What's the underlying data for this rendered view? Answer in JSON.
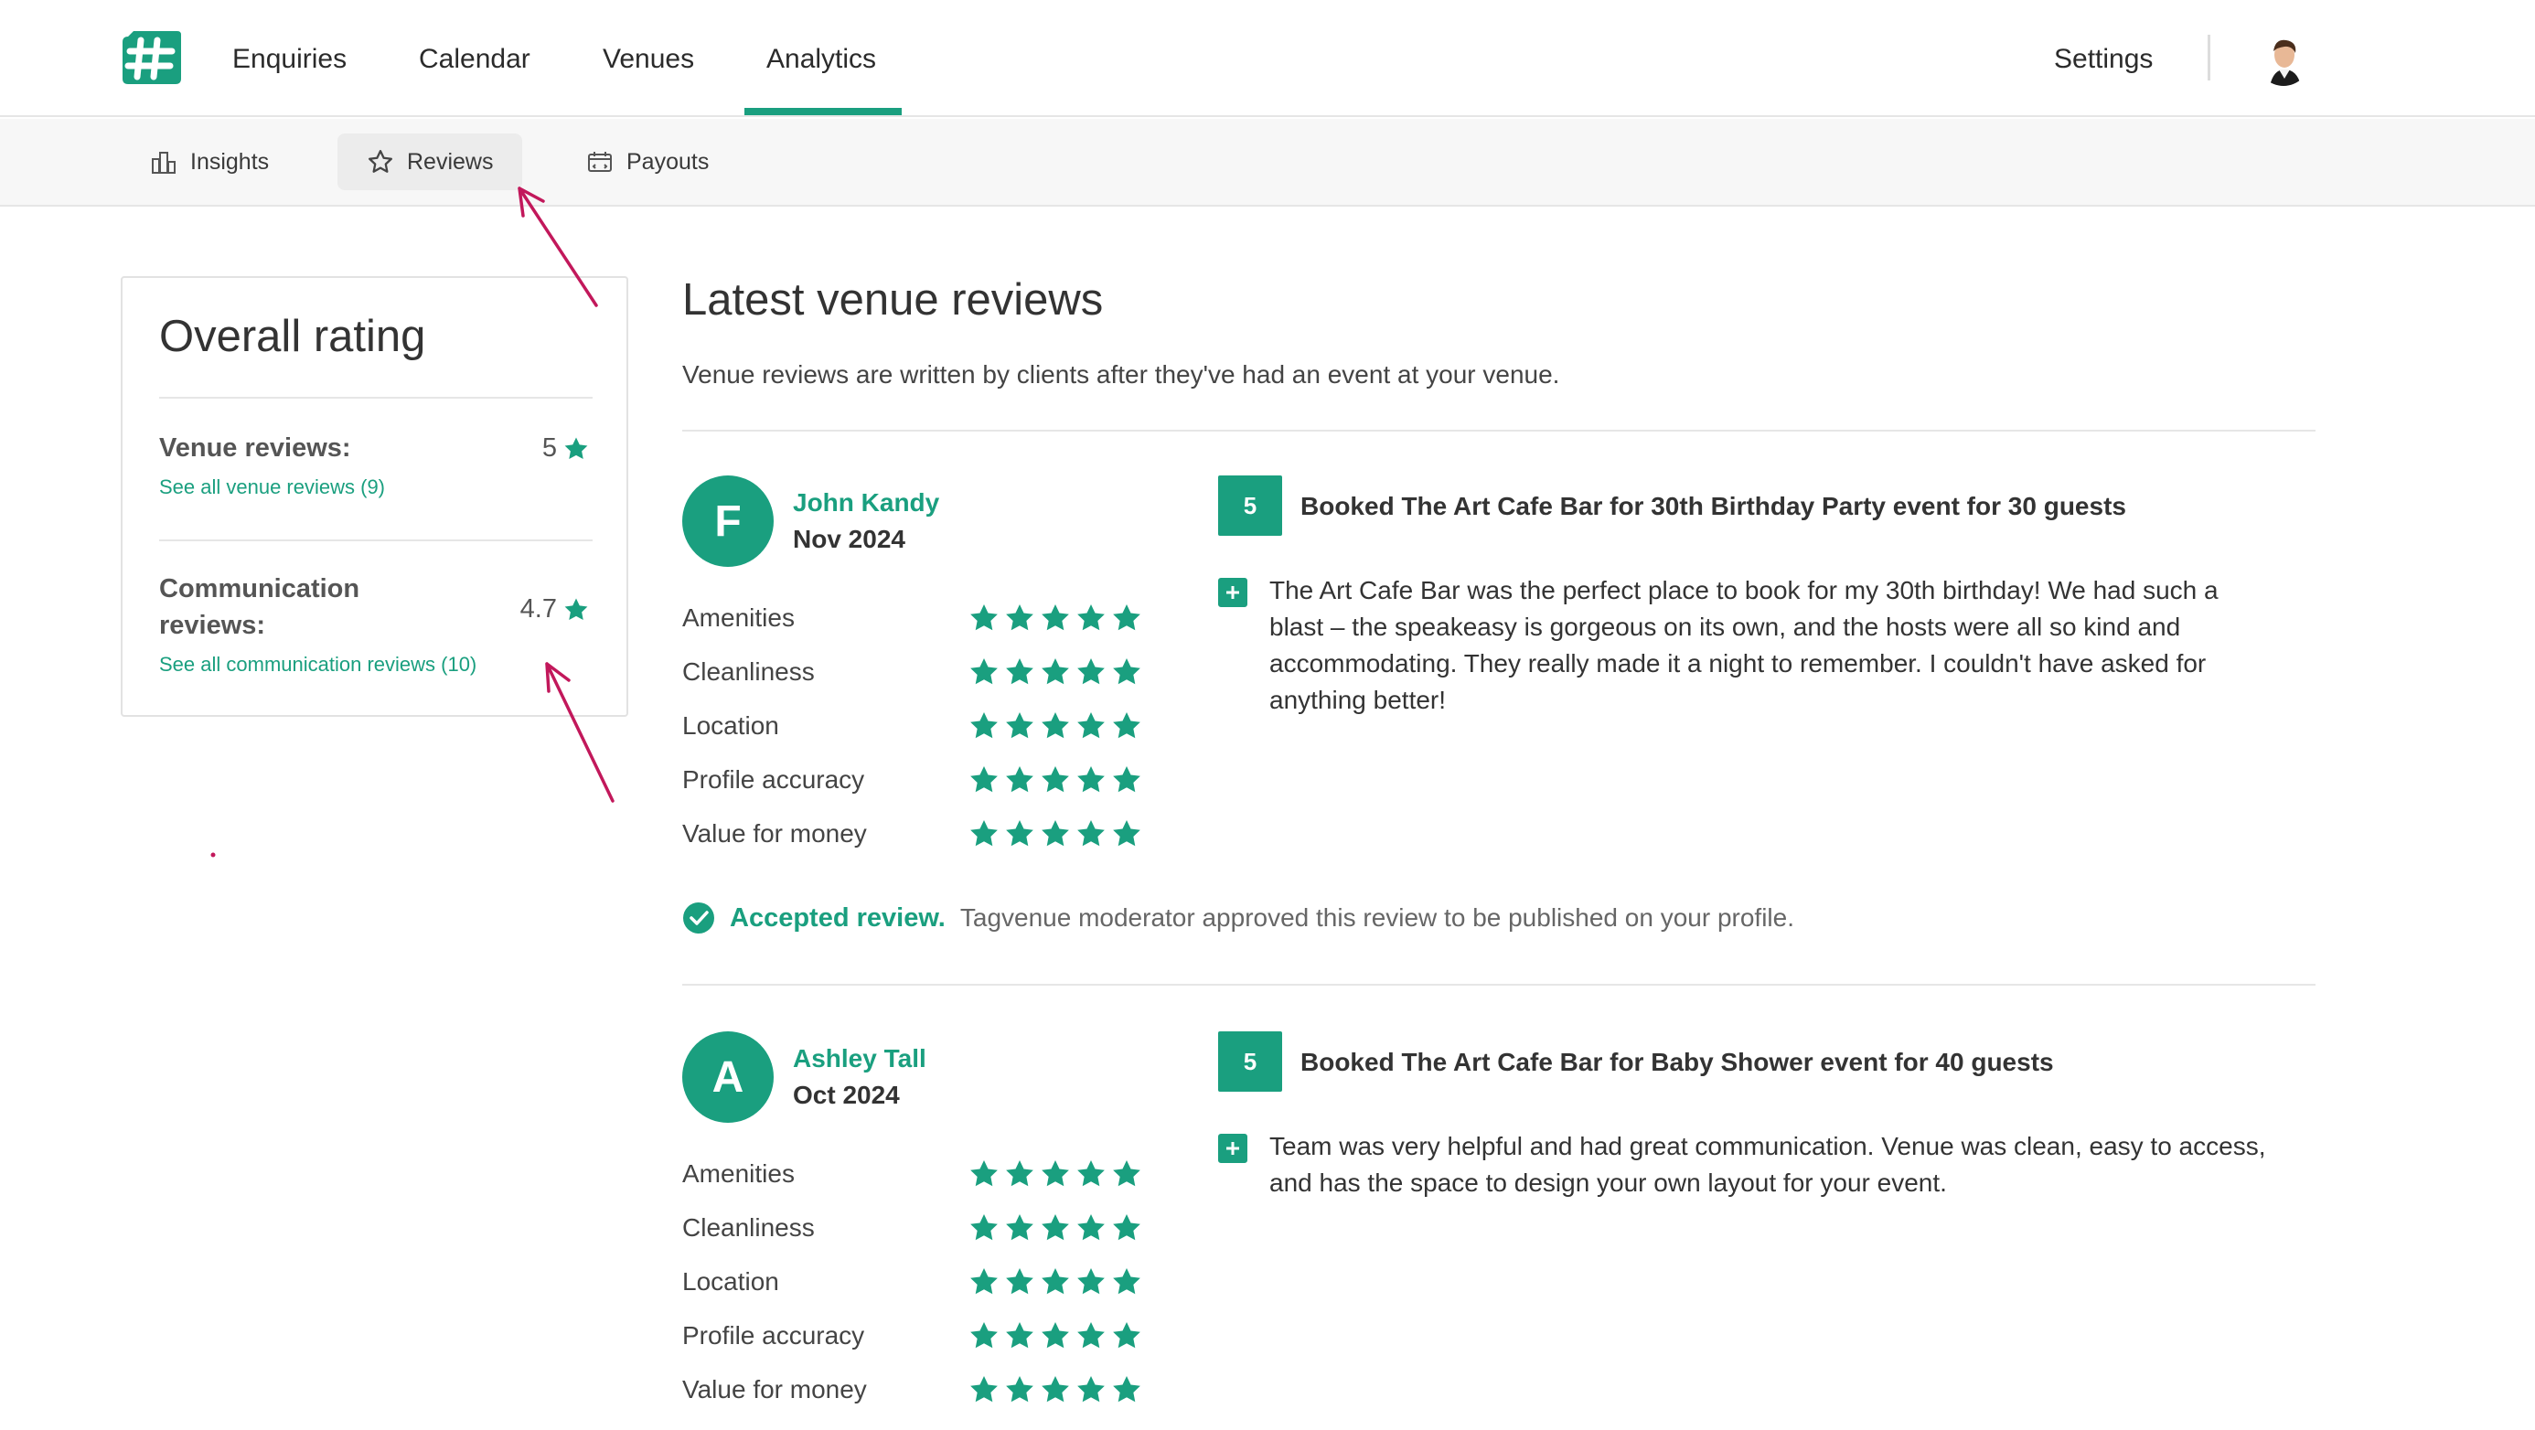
{
  "nav": {
    "items": [
      "Enquiries",
      "Calendar",
      "Venues",
      "Analytics"
    ],
    "active": "Analytics",
    "settings": "Settings"
  },
  "subnav": {
    "insights": "Insights",
    "reviews": "Reviews",
    "payouts": "Payouts"
  },
  "overall": {
    "title": "Overall rating",
    "venue_label": "Venue reviews:",
    "venue_value": "5",
    "venue_link": "See all venue reviews (9)",
    "comm_label_1": "Communication",
    "comm_label_2": "reviews:",
    "comm_value": "4.7",
    "comm_link": "See all communication reviews (10)"
  },
  "main": {
    "title": "Latest venue reviews",
    "subtitle": "Venue reviews are written by clients after they've had an event at your venue."
  },
  "categories": [
    "Amenities",
    "Cleanliness",
    "Location",
    "Profile accuracy",
    "Value for money"
  ],
  "reviews": [
    {
      "initial": "F",
      "name": "John Kandy",
      "date": "Nov 2024",
      "score": "5",
      "booked": "Booked The Art Cafe Bar for 30th Birthday Party event for 30 guests",
      "text_lines": [
        "The Art Cafe Bar was the perfect place to book for my 30th birthday! We had such a",
        "blast – the speakeasy is gorgeous on its own, and the hosts were all so kind and",
        "accommodating. They really made it a night to remember. I couldn't have asked for",
        "anything better!"
      ],
      "ratings": [
        5,
        5,
        5,
        5,
        5
      ]
    },
    {
      "initial": "A",
      "name": "Ashley Tall",
      "date": "Oct 2024",
      "score": "5",
      "booked": "Booked The Art Cafe Bar for Baby Shower event for 40 guests",
      "text_lines": [
        "Team was very helpful and had great communication. Venue was clean, easy to access,",
        "and has the space to design your own layout for your event."
      ],
      "ratings": [
        5,
        5,
        5,
        5,
        5
      ]
    }
  ],
  "accepted": {
    "title": "Accepted review.",
    "desc": "Tagvenue moderator approved this review to be published on your profile."
  },
  "colors": {
    "brand": "#1a9f7f",
    "annotation": "#c2185b"
  },
  "icons": [
    "logo-icon",
    "insights-icon",
    "star-icon",
    "payouts-icon",
    "plus-icon",
    "check-icon"
  ]
}
